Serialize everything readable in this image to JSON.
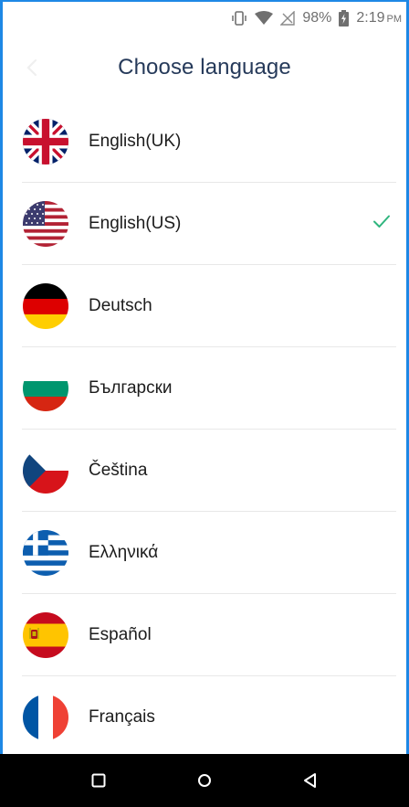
{
  "status_bar": {
    "battery": "98%",
    "time": "2:19",
    "ampm": "PM",
    "icons": [
      "vibrate-icon",
      "wifi-icon",
      "signal-icon",
      "battery-charging-icon"
    ]
  },
  "header": {
    "title": "Choose language",
    "back_icon": "back-arrow-icon"
  },
  "languages": [
    {
      "label": "English(UK)",
      "flag": "uk-flag-icon",
      "selected": false
    },
    {
      "label": "English(US)",
      "flag": "us-flag-icon",
      "selected": true
    },
    {
      "label": "Deutsch",
      "flag": "germany-flag-icon",
      "selected": false
    },
    {
      "label": "Български",
      "flag": "bulgaria-flag-icon",
      "selected": false
    },
    {
      "label": "Čeština",
      "flag": "czech-flag-icon",
      "selected": false
    },
    {
      "label": "Ελληνικά",
      "flag": "greece-flag-icon",
      "selected": false
    },
    {
      "label": "Español",
      "flag": "spain-flag-icon",
      "selected": false
    },
    {
      "label": "Français",
      "flag": "france-flag-icon",
      "selected": false
    }
  ],
  "colors": {
    "accent_check": "#2fb57e",
    "title": "#263a5a",
    "frame": "#1e88e5"
  },
  "nav_bar": {
    "buttons": [
      "recents-icon",
      "home-icon",
      "back-icon"
    ]
  }
}
